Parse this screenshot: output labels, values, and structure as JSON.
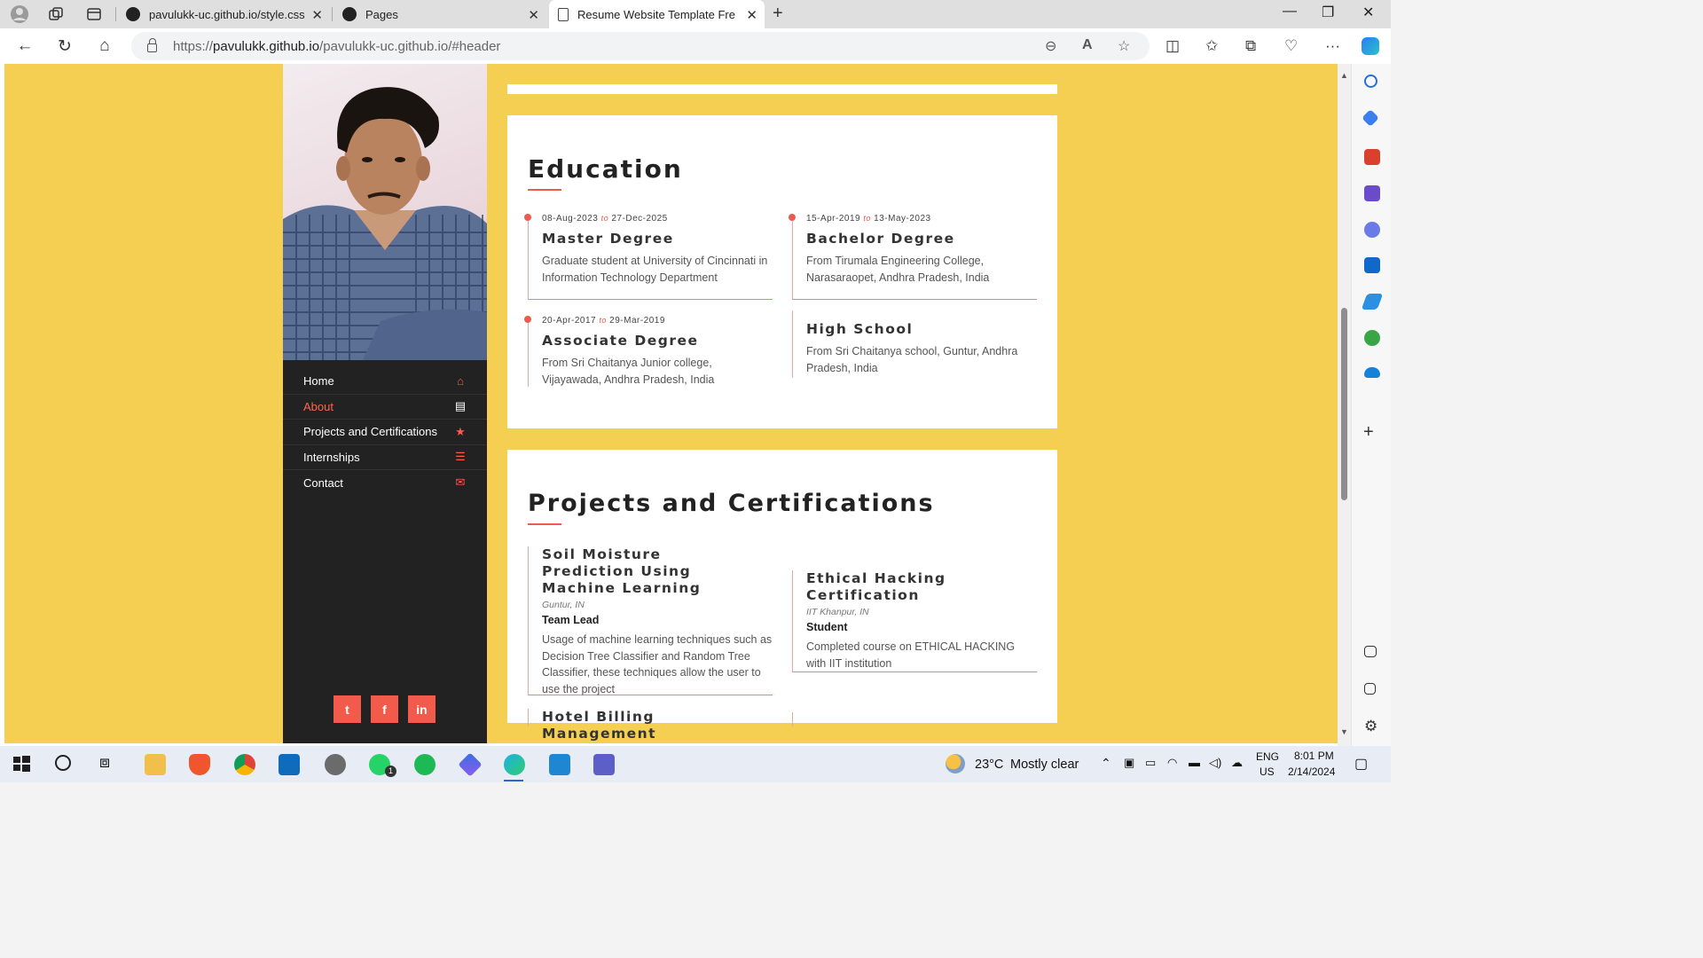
{
  "browser": {
    "tabs": [
      {
        "title": "pavulukk-uc.github.io/style.css at"
      },
      {
        "title": "Pages"
      },
      {
        "title": "Resume Website Template Free D"
      }
    ],
    "url_prefix": "https://",
    "url_host": "pavulukk.github.io",
    "url_path": "/pavulukk-uc.github.io/#header"
  },
  "menu": [
    {
      "label": "Home",
      "icon": "home-icon",
      "glyph": "⌂"
    },
    {
      "label": "About",
      "icon": "id-card-icon",
      "glyph": "▤"
    },
    {
      "label": "Projects and Certifications",
      "icon": "star-icon",
      "glyph": "★"
    },
    {
      "label": "Internships",
      "icon": "list-icon",
      "glyph": "☰"
    },
    {
      "label": "Contact",
      "icon": "envelope-icon",
      "glyph": "✉"
    }
  ],
  "socials": [
    {
      "icon": "twitter-icon",
      "glyph": "t"
    },
    {
      "icon": "facebook-icon",
      "glyph": "f"
    },
    {
      "icon": "linkedin-icon",
      "glyph": "in"
    }
  ],
  "education": {
    "title": "Education",
    "to_word": "to",
    "entries": [
      {
        "start": "08-Aug-2023",
        "end": "27-Dec-2025",
        "degree": "Master Degree",
        "description": "Graduate student at University of Cincinnati in Information Technology Department"
      },
      {
        "start": "15-Apr-2019",
        "end": "13-May-2023",
        "degree": "Bachelor Degree",
        "description": "From Tirumala Engineering College, Narasaraopet, Andhra Pradesh, India"
      },
      {
        "start": "20-Apr-2017",
        "end": "29-Mar-2019",
        "degree": "Associate Degree",
        "description": "From Sri Chaitanya Junior college, Vijayawada, Andhra Pradesh, India"
      },
      {
        "degree": "High School",
        "description": "From Sri Chaitanya school, Guntur, Andhra Pradesh, India"
      }
    ]
  },
  "projects": {
    "title": "Projects and Certifications",
    "entries": [
      {
        "name": "Soil Moisture Prediction Using Machine Learning",
        "location": "Guntur, IN",
        "role": "Team Lead",
        "description": "Usage of machine learning techniques such as Decision Tree Classifier and Random Tree Classifier, these techniques allow the user to use the project"
      },
      {
        "name": "Ethical Hacking Certification",
        "location": "IIT Khanpur, IN",
        "role": "Student",
        "description": "Completed course on ETHICAL HACKING with IIT institution"
      },
      {
        "name": "Hotel Billing Management"
      }
    ]
  },
  "taskbar": {
    "weather_temp": "23°C",
    "weather_text": "Mostly clear",
    "lang": "ENG",
    "region": "US",
    "time": "8:01 PM",
    "date": "2/14/2024",
    "whatsapp_badge": "1"
  },
  "colors": {
    "page_background": "#f5cf52",
    "accent": "#ee5a4d",
    "sidebar": "#222222"
  }
}
